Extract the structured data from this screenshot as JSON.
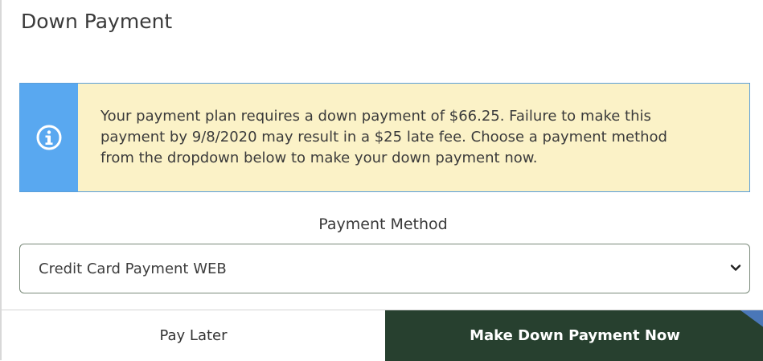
{
  "modal": {
    "title": "Down Payment"
  },
  "alert": {
    "icon": "info-circle-icon",
    "message": "Your payment plan requires a down payment of $66.25. Failure to make this payment by 9/8/2020 may result in a $25 late fee. Choose a payment method from the dropdown below to make your down payment now.",
    "colors": {
      "icon_bg": "#59a8f0",
      "body_bg": "#fbf2c7"
    }
  },
  "payment_method": {
    "label": "Payment Method",
    "selected": "Credit Card Payment WEB"
  },
  "footer": {
    "pay_later_label": "Pay Later",
    "pay_now_label": "Make Down Payment Now",
    "colors": {
      "pay_now_bg": "#27402f"
    }
  }
}
